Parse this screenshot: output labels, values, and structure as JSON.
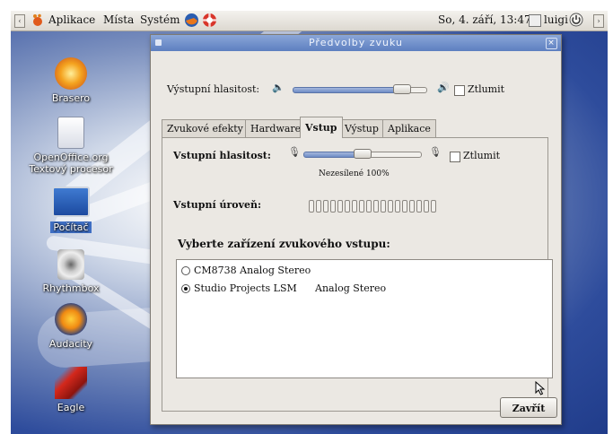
{
  "panel": {
    "menus": [
      "Aplikace",
      "Místa",
      "Systém"
    ],
    "datetime": "So, 4. září, 13:47",
    "user": "luigi"
  },
  "desktop_icons": [
    {
      "label": "Brasero"
    },
    {
      "label": "OpenOffice.org Textový procesor"
    },
    {
      "label": "Počítač"
    },
    {
      "label": "Rhythmbox"
    },
    {
      "label": "Audacity"
    },
    {
      "label": "Eagle"
    }
  ],
  "window": {
    "title": "Předvolby zvuku",
    "output_volume_label": "Výstupní hlasitost:",
    "output_volume_level": 0.82,
    "mute_label": "Ztlumit",
    "tabs": [
      "Zvukové efekty",
      "Hardware",
      "Vstup",
      "Výstup",
      "Aplikace"
    ],
    "active_tab": "Vstup",
    "input_volume_label": "Vstupní hlasitost:",
    "input_volume_level": 0.5,
    "input_mute_label": "Ztlumit",
    "input_scale_label": "Nezesílené 100%",
    "input_level_label": "Vstupní úroveň:",
    "device_heading": "Vyberte zařízení zvukového vstupu:",
    "devices": [
      {
        "name": "CM8738 Analog Stereo",
        "port": "",
        "selected": false
      },
      {
        "name": "Studio Projects LSM",
        "port": "Analog Stereo",
        "selected": true
      }
    ],
    "close_button": "Zavřít"
  }
}
